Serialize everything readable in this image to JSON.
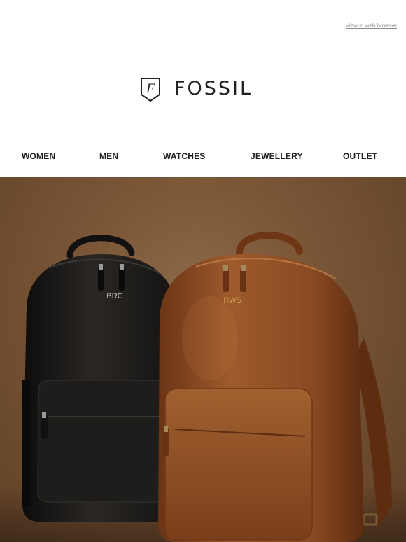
{
  "header": {
    "web_link": "View in web browser"
  },
  "brand": {
    "name": "FOSSIL",
    "logo_letter": "F"
  },
  "nav": {
    "items": [
      {
        "label": "WOMEN"
      },
      {
        "label": "MEN"
      },
      {
        "label": "WATCHES"
      },
      {
        "label": "JEWELLERY"
      },
      {
        "label": "OUTLET"
      }
    ]
  },
  "hero": {
    "monogram_black": "BRC",
    "monogram_brown": "RWS"
  },
  "colors": {
    "text": "#1e1e1e",
    "link_gray": "#8a8a8a",
    "backdrop": "#7a5637",
    "bag_black": "#1c1a18",
    "bag_brown": "#8a4a22",
    "monogram_silver": "#d8d8d8",
    "monogram_gold": "#c9a24a"
  }
}
